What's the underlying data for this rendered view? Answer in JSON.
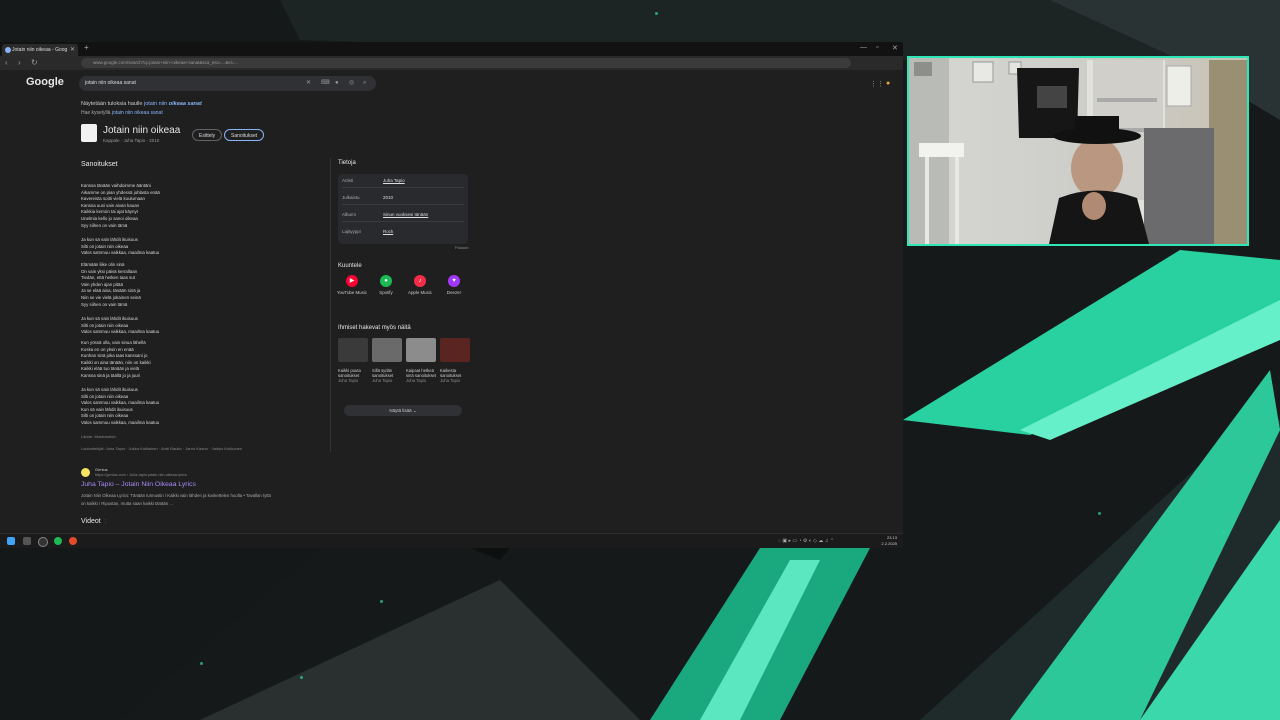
{
  "browser": {
    "tab_title": "Jotain niin oikeaa - Goog",
    "address": "www.google.com/search?q=jotain+niin+oikeaa+sanat&sca_esv=...&ei=..."
  },
  "google": {
    "logo": "Google",
    "query": "jotain niin oikeaa sanat",
    "correction_prefix": "Näytetään tuloksia haulle",
    "correction_normal": "jotain niin",
    "correction_italic": "oikeaa sanat",
    "instead_prefix": "Hae kyselyllä",
    "instead_link": "jotain niin oikeaa sanat",
    "song_title": "Jotain niin oikeaa",
    "song_subtitle": "Kappale · Juha Tapio · 2010",
    "chip_overview": "Esittely",
    "chip_lyrics": "Sanoitukset",
    "lyrics_heading": "Sanoitukset",
    "stanzas": [
      [
        "Kanssa tänään vaihdoimme ääntäni",
        "Aikamme on pian yhdessä juhlasta enää",
        "Kavereista soitti vielä kuulumaan",
        "Kanssa uusi vain aivan kauan",
        "Kaikkia kerroin tai ajat käynyt",
        "Unelmia kello jo sanoi oikeaa",
        "Syy siihen on vain tämä"
      ],
      [
        "Ja kun sä vain lähdit ikuisuus",
        "Silti on jotain niin oikeaa",
        "Valos sammuu vaikkaa, maailma kaatuu"
      ],
      [
        "Elämään liike olin sinä",
        "On vain yksi päivä kerrallaan",
        "Tiedän, että hetken taas sut",
        "Vain yhden ajan pitää",
        "Ja se elää aina, tänään sinä ja",
        "Niin se vie vielä jokainen seinä",
        "Syy siihen on vain tämä"
      ],
      [
        "Ja kun sä vain lähdit ikuisuus",
        "Silti on jotain niin oikeaa",
        "Valos sammuu vaikkaa, maailma kaatuu"
      ],
      [
        "Kun yössä olla, vain sinua lähellä",
        "Koska en on yksin en enää",
        "Kunhan sinä joka taas kanssani jo",
        "Kaikki on aina tänään, niin on kaikki",
        "Kaikki elää tuo tänään ja vielä",
        "Kanssa sinä ja täällä jo ja juuri"
      ],
      [
        "Ja kun sä vain lähdit ikuisuus",
        "Silti on jotain niin oikeaa",
        "Valos sammuu vaikkaa, maailma kaatuu",
        "Kun sä vain lähdit ikuisuus",
        "Silti on jotain niin oikeaa",
        "Valos sammuu vaikkaa, maailma kaatuu"
      ]
    ],
    "source": "Lähde: Musixmatch",
    "writers": "Lauluntekijät: Juha Tapio · Jukka Kotilainen · Antti Rautio · Jarno Kaario · Jarkko Kokkonen",
    "info_heading": "Tietoja",
    "info_rows": [
      {
        "key": "Artisti",
        "value": "Juha Tapio"
      },
      {
        "key": "Julkaistu",
        "value": "2010"
      },
      {
        "key": "Albumi",
        "value": "Sinun vuoksesi tänään"
      },
      {
        "key": "Lajityyppi",
        "value": "Rock"
      }
    ],
    "feedback": "Palaute",
    "listen_heading": "Kuuntele",
    "services": [
      {
        "name": "YouTube Music",
        "color": "#ff0033",
        "icon": "▶"
      },
      {
        "name": "Spotify",
        "color": "#1db954",
        "icon": "●"
      },
      {
        "name": "Apple Music",
        "color": "#fa2d48",
        "icon": "♪"
      },
      {
        "name": "Deezer",
        "color": "#a238ff",
        "icon": "♥"
      }
    ],
    "also_heading": "Ihmiset hakevat myös näitä",
    "also": [
      {
        "title": "Kaikki puuta sanoitukset",
        "artist": "Juha Tapio",
        "color": "#3a3a3a"
      },
      {
        "title": "Sillä sydän sanoitukset",
        "artist": "Juha Tapio",
        "color": "#6a6a6a"
      },
      {
        "title": "Kaipaat hetkeä sinä sanoitukset",
        "artist": "Juha Tapio",
        "color": "#8c8c8c"
      },
      {
        "title": "Kaikesta sanoitukset",
        "artist": "Juha Tapio",
        "color": "#5a2520"
      }
    ],
    "show_more": "Näytä lisää",
    "result": {
      "site": "Genius",
      "url": "https://genius.com › Juha-tapio-jotain-niin-oikeaa-lyrics",
      "title": "Juha Tapio – Jotain Niin Oikeaa Lyrics",
      "snippet1": "Jotain Niin Oikeaa Lyrics: Tänään tunnustin / Kaikki vain lähden ja koskettelen huolta • Tavallan tyttö",
      "snippet2": "on kaikki / Ripustan, mutta saan kaikki tänään ..."
    },
    "videos_heading": "Videot"
  },
  "taskbar": {
    "time": "23.13",
    "date": "2.2.2025"
  }
}
